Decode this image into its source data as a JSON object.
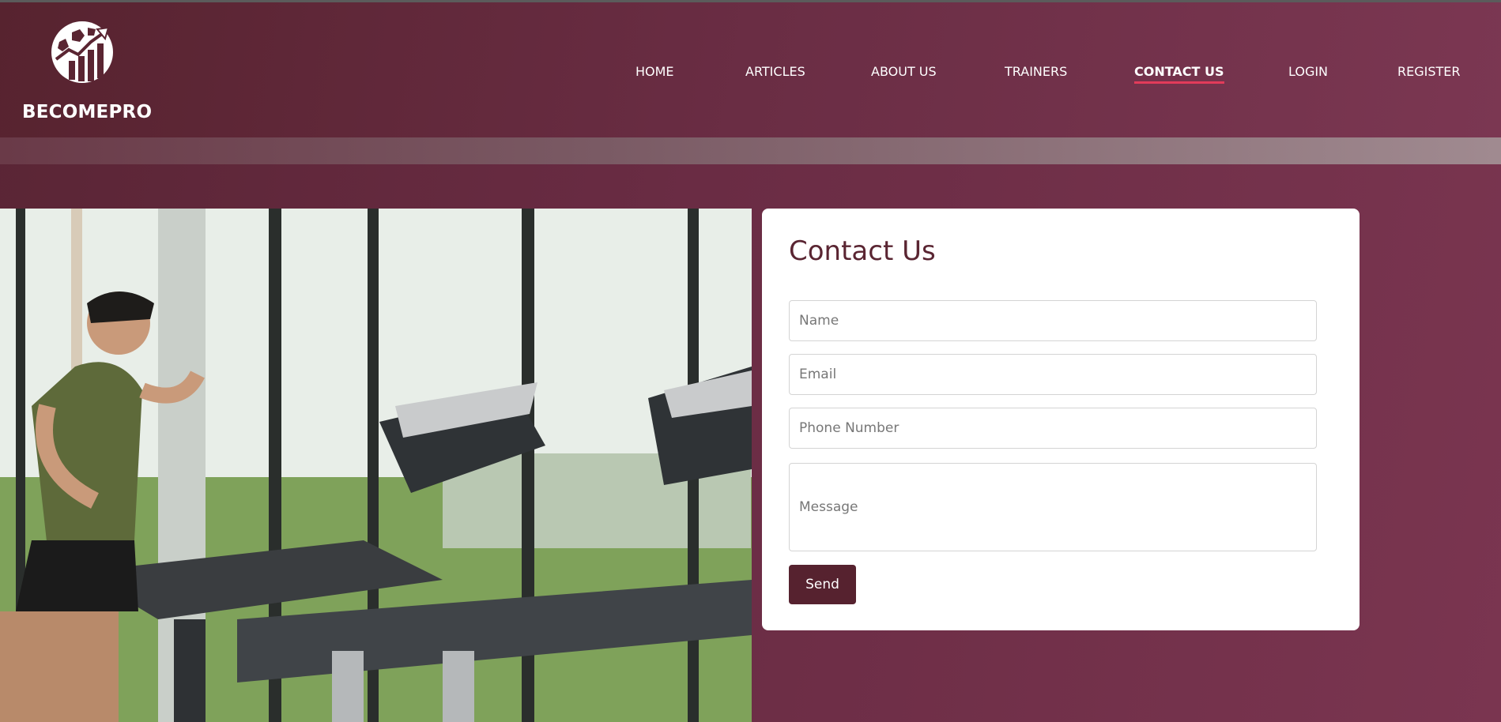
{
  "brand": {
    "name": "BECOMEPRO",
    "logo_icon": "soccer-ball-bar-chart-logo"
  },
  "nav": {
    "items": [
      {
        "label": "HOME",
        "active": false
      },
      {
        "label": "ARTICLES",
        "active": false
      },
      {
        "label": "ABOUT US",
        "active": false
      },
      {
        "label": "TRAINERS",
        "active": false
      },
      {
        "label": "CONTACT US",
        "active": true
      },
      {
        "label": "LOGIN",
        "active": false
      },
      {
        "label": "REGISTER",
        "active": false
      }
    ]
  },
  "hero_image": {
    "subject": "man running on treadmill in gym"
  },
  "contact": {
    "title": "Contact Us",
    "name_placeholder": "Name",
    "email_placeholder": "Email",
    "phone_placeholder": "Phone Number",
    "message_placeholder": "Message",
    "send_label": "Send"
  },
  "colors": {
    "brand_maroon": "#5a2532",
    "active_underline": "#e23b5a",
    "card_background": "#ffffff"
  }
}
